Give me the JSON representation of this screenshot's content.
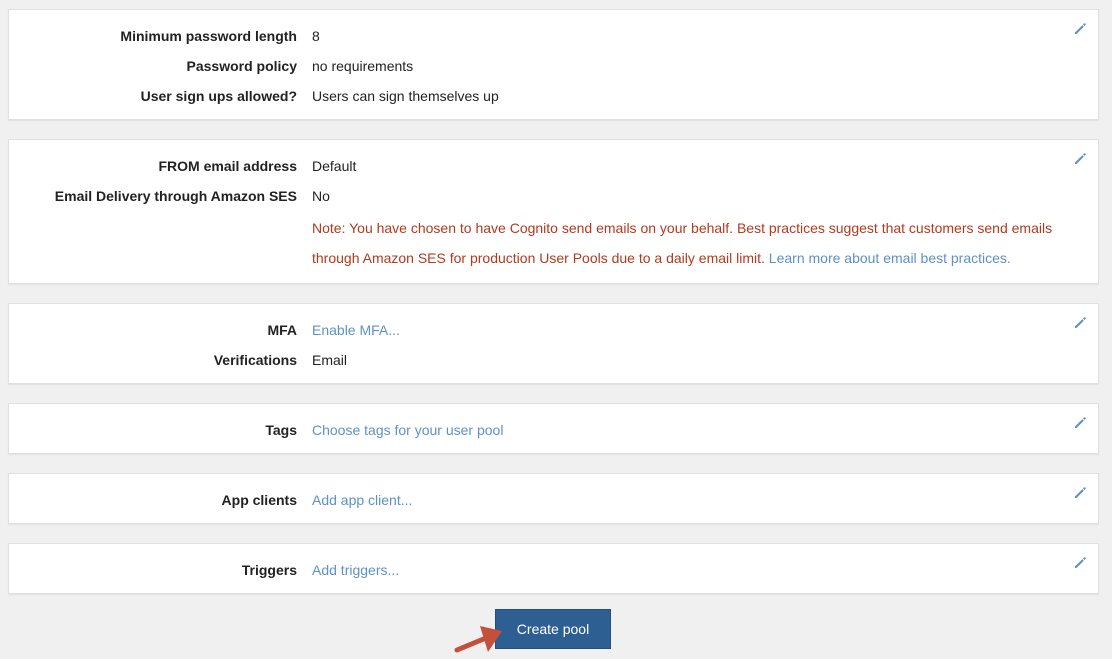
{
  "sections": {
    "password": {
      "min_length_label": "Minimum password length",
      "min_length_value": "8",
      "policy_label": "Password policy",
      "policy_value": "no requirements",
      "signups_label": "User sign ups allowed?",
      "signups_value": "Users can sign themselves up"
    },
    "email": {
      "from_label": "FROM email address",
      "from_value": "Default",
      "ses_label": "Email Delivery through Amazon SES",
      "ses_value": "No",
      "note_text": "Note: You have chosen to have Cognito send emails on your behalf. Best practices suggest that customers send emails through Amazon SES for production User Pools due to a daily email limit.",
      "note_link": "Learn more about email best practices."
    },
    "mfa": {
      "mfa_label": "MFA",
      "mfa_value": "Enable MFA...",
      "verifications_label": "Verifications",
      "verifications_value": "Email"
    },
    "tags": {
      "label": "Tags",
      "value": "Choose tags for your user pool"
    },
    "app_clients": {
      "label": "App clients",
      "value": "Add app client..."
    },
    "triggers": {
      "label": "Triggers",
      "value": "Add triggers..."
    }
  },
  "actions": {
    "create_pool": "Create pool"
  },
  "icons": {
    "edit": "pencil-icon",
    "annotation": "arrow-icon"
  },
  "colors": {
    "link": "#5e91c8",
    "warning": "#b23a1f",
    "primary_button": "#2e5f92",
    "annotation_arrow": "#c5503a"
  }
}
